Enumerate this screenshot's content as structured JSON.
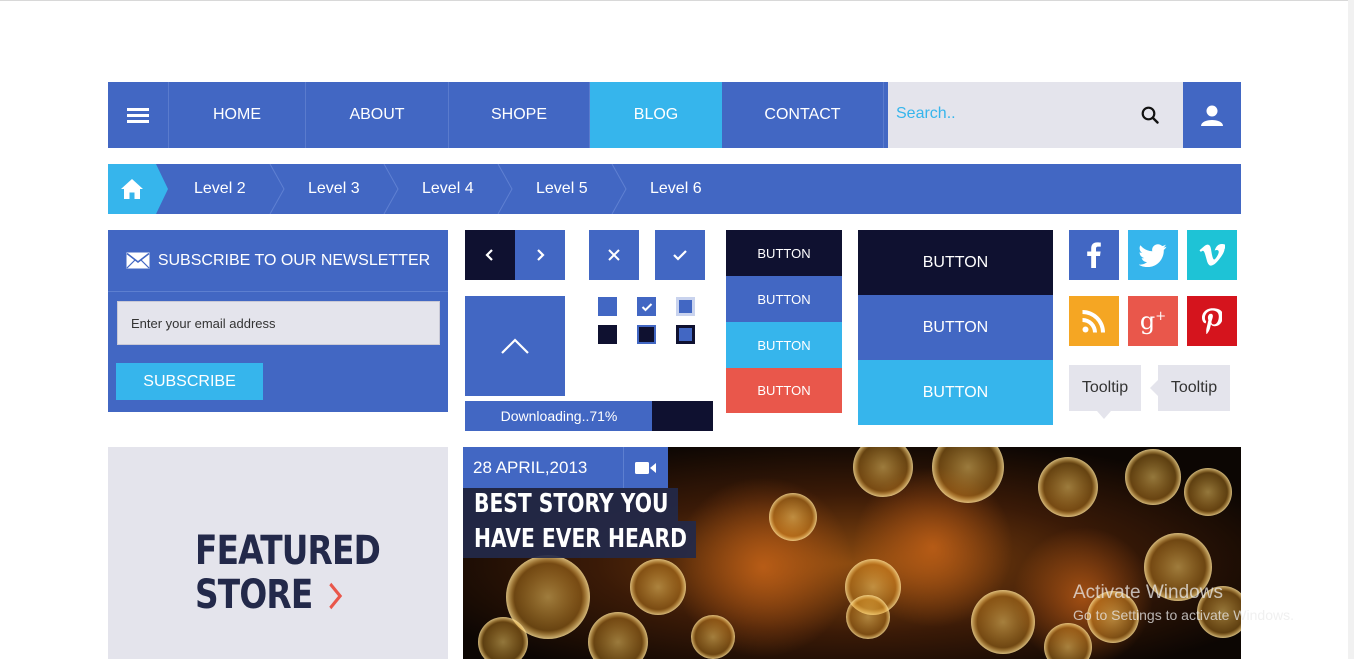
{
  "nav": {
    "items": [
      {
        "label": "HOME"
      },
      {
        "label": "ABOUT"
      },
      {
        "label": "SHOPE"
      },
      {
        "label": "BLOG"
      },
      {
        "label": "CONTACT"
      }
    ],
    "active_item": "BLOG",
    "search_placeholder": "Search.."
  },
  "breadcrumb": {
    "levels": [
      "Level 2",
      "Level 3",
      "Level 4",
      "Level 5",
      "Level 6"
    ]
  },
  "newsletter": {
    "title": "SUBSCRIBE TO OUR NEWSLETTER",
    "email_placeholder": "Enter your email address",
    "subscribe_label": "SUBSCRIBE"
  },
  "progress": {
    "label": "Downloading..71%",
    "value": 0.71
  },
  "small_buttons": {
    "prev_icon": "chevron-left-icon",
    "next_icon": "chevron-right-icon",
    "close_icon": "close-icon",
    "check_icon": "check-icon",
    "up_icon": "chevron-up-icon"
  },
  "button_stack_small": [
    "BUTTON",
    "BUTTON",
    "BUTTON",
    "BUTTON"
  ],
  "button_stack_large": [
    "BUTTON",
    "BUTTON",
    "BUTTON"
  ],
  "social": [
    "facebook-icon",
    "twitter-icon",
    "vimeo-icon",
    "rss-icon",
    "google-plus-icon",
    "pinterest-icon"
  ],
  "tooltips": [
    "Tooltip",
    "Tooltip"
  ],
  "featured": {
    "line1": "FEATURED",
    "line2": "STORE"
  },
  "hero": {
    "date": "28 APRIL,2013",
    "title_line1": "BEST STORY YOU",
    "title_line2": "HAVE EVER HEARD"
  },
  "watermark": {
    "title": "Activate Windows",
    "subtitle": "Go to Settings to activate Windows."
  },
  "colors": {
    "primary": "#4267c3",
    "accent": "#36b5ec",
    "dark": "#0f1130",
    "danger": "#e9574b",
    "light_gray": "#e4e4ec"
  }
}
